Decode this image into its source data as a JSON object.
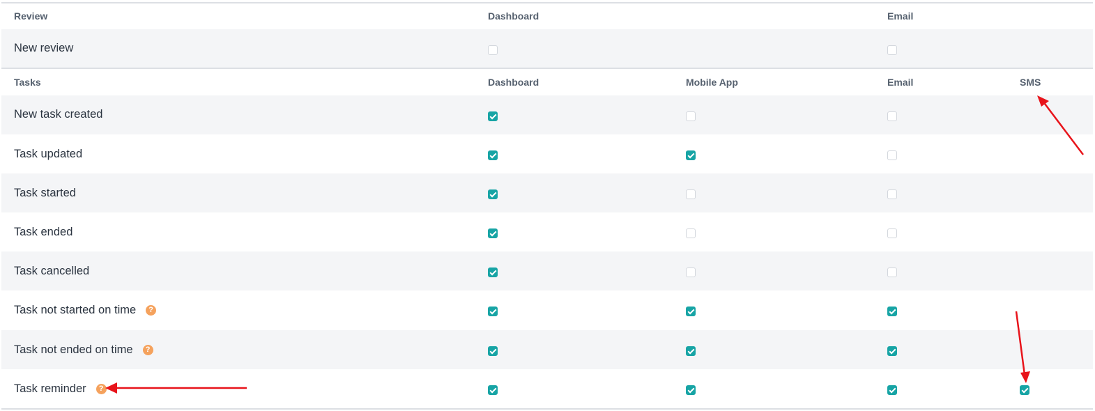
{
  "review_section": {
    "header": {
      "title": "Review",
      "col_dashboard": "Dashboard",
      "col_email": "Email"
    },
    "rows": [
      {
        "label": "New review",
        "dashboard": false,
        "email": false
      }
    ]
  },
  "tasks_section": {
    "header": {
      "title": "Tasks",
      "col_dashboard": "Dashboard",
      "col_mobile": "Mobile App",
      "col_email": "Email",
      "col_sms": "SMS"
    },
    "rows": [
      {
        "label": "New task created",
        "help": false,
        "dashboard": true,
        "mobile": false,
        "email": false,
        "sms": null
      },
      {
        "label": "Task updated",
        "help": false,
        "dashboard": true,
        "mobile": true,
        "email": false,
        "sms": null
      },
      {
        "label": "Task started",
        "help": false,
        "dashboard": true,
        "mobile": false,
        "email": false,
        "sms": null
      },
      {
        "label": "Task ended",
        "help": false,
        "dashboard": true,
        "mobile": false,
        "email": false,
        "sms": null
      },
      {
        "label": "Task cancelled",
        "help": false,
        "dashboard": true,
        "mobile": false,
        "email": false,
        "sms": null
      },
      {
        "label": "Task not started on time",
        "help": true,
        "dashboard": true,
        "mobile": true,
        "email": true,
        "sms": null
      },
      {
        "label": "Task not ended on time",
        "help": true,
        "dashboard": true,
        "mobile": true,
        "email": true,
        "sms": null
      },
      {
        "label": "Task reminder",
        "help": true,
        "dashboard": true,
        "mobile": true,
        "email": true,
        "sms": true
      }
    ]
  },
  "help_glyph": "?",
  "colors": {
    "checked": "#17a4a5",
    "help_icon": "#f5a25d",
    "annotation_arrow": "#e8141b",
    "row_alt": "#f4f5f7"
  }
}
